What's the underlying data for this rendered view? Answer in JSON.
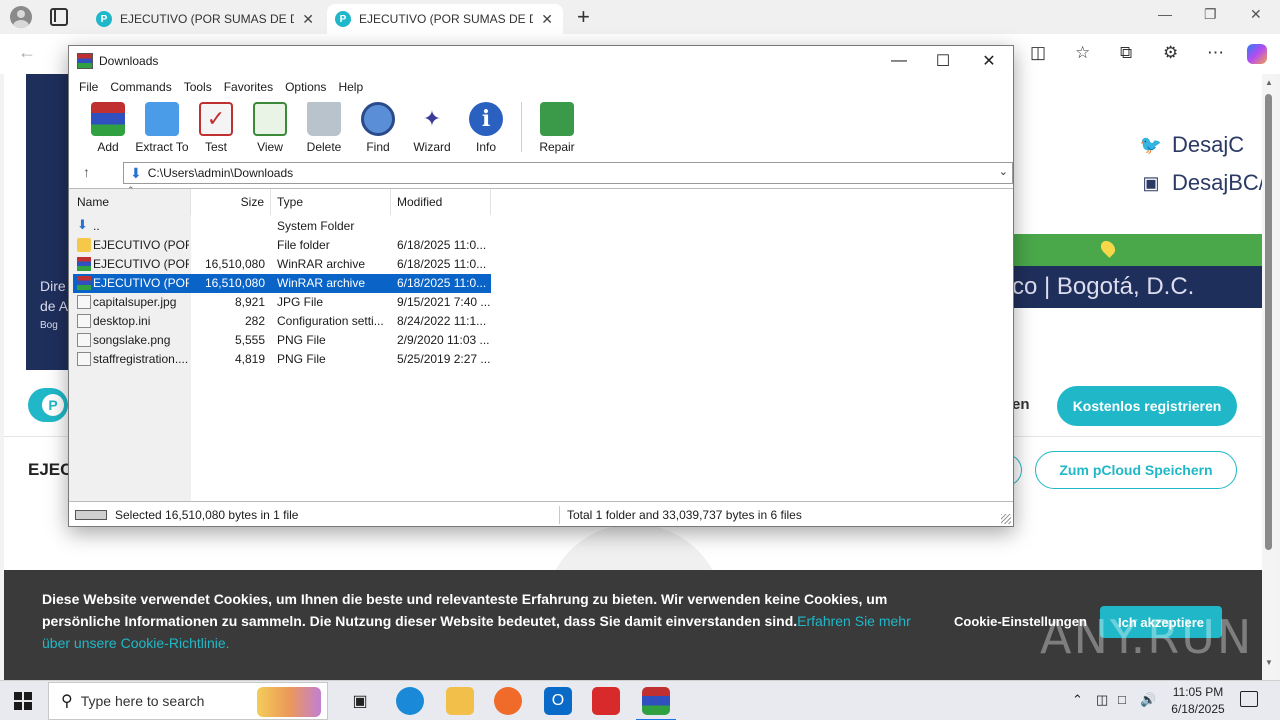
{
  "browser": {
    "tabs": [
      {
        "title": "EJECUTIVO (POR SUMAS DE DINE",
        "favicon": "P",
        "active": false
      },
      {
        "title": "EJECUTIVO (POR SUMAS DE DINE",
        "favicon": "P",
        "active": true
      }
    ],
    "new_tab_glyph": "+",
    "close_glyph": "✕"
  },
  "page": {
    "social": [
      {
        "icon": "twitter-icon",
        "handle": "DesajC"
      },
      {
        "icon": "instagram-icon",
        "handle": "DesajBC/"
      }
    ],
    "hero_location": "co  |  Bogotá, D.C.",
    "hero_left_lines": [
      "Dire",
      "de A",
      "Bog"
    ],
    "login_fragment": "en",
    "register_button": "Kostenlos registrieren",
    "file_title": "EJEC",
    "save_button": "Zum pCloud Speichern",
    "cookie": {
      "message": "Diese Website verwendet Cookies, um Ihnen die beste und relevanteste Erfahrung zu bieten. Wir verwenden keine Cookies, um persönliche Informationen zu sammeln. Die Nutzung dieser Website bedeutet, dass Sie damit einverstanden sind.",
      "link": "Erfahren Sie mehr über unsere Cookie-Richtlinie.",
      "settings": "Cookie-Einstellungen",
      "accept": "Ich akzeptiere"
    },
    "watermark": "ANY.RUN",
    "colors": {
      "accent": "#20b8c8",
      "navy": "#1f2f5c",
      "green": "#4aa84a",
      "cookie_bg": "#3a3a3a"
    }
  },
  "winrar": {
    "title": "Downloads",
    "menu": [
      "File",
      "Commands",
      "Tools",
      "Favorites",
      "Options",
      "Help"
    ],
    "toolbar": [
      {
        "label": "Add",
        "icon": "add-archive-icon"
      },
      {
        "label": "Extract To",
        "icon": "extract-folder-icon"
      },
      {
        "label": "Test",
        "icon": "test-clipboard-icon"
      },
      {
        "label": "View",
        "icon": "view-book-icon"
      },
      {
        "label": "Delete",
        "icon": "delete-bin-icon"
      },
      {
        "label": "Find",
        "icon": "find-magnifier-icon"
      },
      {
        "label": "Wizard",
        "icon": "wizard-wand-icon"
      },
      {
        "label": "Info",
        "icon": "info-icon"
      },
      {
        "label": "Repair",
        "icon": "repair-kit-icon"
      }
    ],
    "path": "C:\\Users\\admin\\Downloads",
    "columns": [
      "Name",
      "Size",
      "Type",
      "Modified"
    ],
    "files": [
      {
        "name": "..",
        "size": "",
        "type": "System Folder",
        "modified": "",
        "icon": "up-arrow-icon",
        "selected": false
      },
      {
        "name": "EJECUTIVO (POR...",
        "size": "",
        "type": "File folder",
        "modified": "6/18/2025 11:0...",
        "icon": "folder-icon",
        "selected": false
      },
      {
        "name": "EJECUTIVO (POR...",
        "size": "16,510,080",
        "type": "WinRAR archive",
        "modified": "6/18/2025 11:0...",
        "icon": "rar-archive-icon",
        "selected": false
      },
      {
        "name": "EJECUTIVO (POR...",
        "size": "16,510,080",
        "type": "WinRAR archive",
        "modified": "6/18/2025 11:0...",
        "icon": "rar-archive-icon",
        "selected": true
      },
      {
        "name": "capitalsuper.jpg",
        "size": "8,921",
        "type": "JPG File",
        "modified": "9/15/2021 7:40 ...",
        "icon": "image-file-icon",
        "selected": false
      },
      {
        "name": "desktop.ini",
        "size": "282",
        "type": "Configuration setti...",
        "modified": "8/24/2022 11:1...",
        "icon": "settings-file-icon",
        "selected": false
      },
      {
        "name": "songslake.png",
        "size": "5,555",
        "type": "PNG File",
        "modified": "2/9/2020 11:03 ...",
        "icon": "image-file-icon",
        "selected": false
      },
      {
        "name": "staffregistration....",
        "size": "4,819",
        "type": "PNG File",
        "modified": "5/25/2019 2:27 ...",
        "icon": "image-file-icon",
        "selected": false
      }
    ],
    "status_left": "Selected 16,510,080 bytes in 1 file",
    "status_right": "Total 1 folder and 33,039,737 bytes in 6 files"
  },
  "taskbar": {
    "search_placeholder": "Type here to search",
    "apps": [
      "task-view-icon",
      "edge-icon",
      "file-explorer-icon",
      "firefox-icon",
      "outlook-icon",
      "acrobat-icon",
      "winrar-icon"
    ],
    "time": "11:05 PM",
    "date": "6/18/2025"
  }
}
